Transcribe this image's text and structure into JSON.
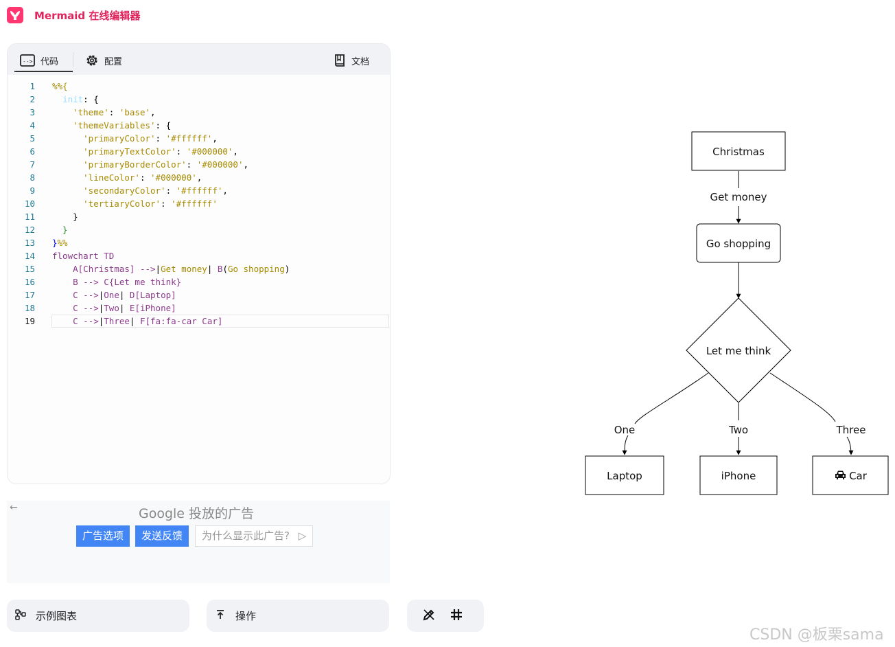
{
  "app": {
    "title": "Mermaid 在线编辑器",
    "logo_icon": "mermaid-logo-icon",
    "brand_color": "#e0245e"
  },
  "editor": {
    "tabs": {
      "code": "代码",
      "config": "配置",
      "docs": "文档"
    },
    "active_tab": "code",
    "current_line": 19,
    "lines": [
      [
        {
          "t": "%%{",
          "c": "#a68a00"
        }
      ],
      [
        {
          "t": "  ",
          "c": "#000"
        },
        {
          "t": "init",
          "c": "#9cdcfe"
        },
        {
          "t": ": {",
          "c": "#000"
        }
      ],
      [
        {
          "t": "    ",
          "c": "#000"
        },
        {
          "t": "'theme'",
          "c": "#a68a00"
        },
        {
          "t": ": ",
          "c": "#000"
        },
        {
          "t": "'base'",
          "c": "#a68a00"
        },
        {
          "t": ",",
          "c": "#000"
        }
      ],
      [
        {
          "t": "    ",
          "c": "#000"
        },
        {
          "t": "'themeVariables'",
          "c": "#a68a00"
        },
        {
          "t": ": {",
          "c": "#000"
        }
      ],
      [
        {
          "t": "      ",
          "c": "#000"
        },
        {
          "t": "'primaryColor'",
          "c": "#a68a00"
        },
        {
          "t": ": ",
          "c": "#000"
        },
        {
          "t": "'#ffffff'",
          "c": "#a68a00"
        },
        {
          "t": ",",
          "c": "#000"
        }
      ],
      [
        {
          "t": "      ",
          "c": "#000"
        },
        {
          "t": "'primaryTextColor'",
          "c": "#a68a00"
        },
        {
          "t": ": ",
          "c": "#000"
        },
        {
          "t": "'#000000'",
          "c": "#a68a00"
        },
        {
          "t": ",",
          "c": "#000"
        }
      ],
      [
        {
          "t": "      ",
          "c": "#000"
        },
        {
          "t": "'primaryBorderColor'",
          "c": "#a68a00"
        },
        {
          "t": ": ",
          "c": "#000"
        },
        {
          "t": "'#000000'",
          "c": "#a68a00"
        },
        {
          "t": ",",
          "c": "#000"
        }
      ],
      [
        {
          "t": "      ",
          "c": "#000"
        },
        {
          "t": "'lineColor'",
          "c": "#a68a00"
        },
        {
          "t": ": ",
          "c": "#000"
        },
        {
          "t": "'#000000'",
          "c": "#a68a00"
        },
        {
          "t": ",",
          "c": "#000"
        }
      ],
      [
        {
          "t": "      ",
          "c": "#000"
        },
        {
          "t": "'secondaryColor'",
          "c": "#a68a00"
        },
        {
          "t": ": ",
          "c": "#000"
        },
        {
          "t": "'#ffffff'",
          "c": "#a68a00"
        },
        {
          "t": ",",
          "c": "#000"
        }
      ],
      [
        {
          "t": "      ",
          "c": "#000"
        },
        {
          "t": "'tertiaryColor'",
          "c": "#a68a00"
        },
        {
          "t": ": ",
          "c": "#000"
        },
        {
          "t": "'#ffffff'",
          "c": "#a68a00"
        }
      ],
      [
        {
          "t": "    }",
          "c": "#000"
        }
      ],
      [
        {
          "t": "  }",
          "c": "#2e8b2e"
        }
      ],
      [
        {
          "t": "}",
          "c": "#0000ff"
        },
        {
          "t": "%%",
          "c": "#a68a00"
        }
      ],
      [
        {
          "t": "flowchart TD",
          "c": "#8b3a8b"
        }
      ],
      [
        {
          "t": "    A",
          "c": "#8b3a8b"
        },
        {
          "t": "[Christmas]",
          "c": "#8b3a8b"
        },
        {
          "t": " -->",
          "c": "#8b3a8b"
        },
        {
          "t": "|",
          "c": "#000"
        },
        {
          "t": "Get money",
          "c": "#a68a00"
        },
        {
          "t": "|",
          "c": "#000"
        },
        {
          "t": " B",
          "c": "#8b3a8b"
        },
        {
          "t": "(",
          "c": "#000"
        },
        {
          "t": "Go shopping",
          "c": "#a68a00"
        },
        {
          "t": ")",
          "c": "#000"
        }
      ],
      [
        {
          "t": "    B",
          "c": "#8b3a8b"
        },
        {
          "t": " --> ",
          "c": "#8b3a8b"
        },
        {
          "t": "C{Let me think}",
          "c": "#8b3a8b"
        }
      ],
      [
        {
          "t": "    C",
          "c": "#8b3a8b"
        },
        {
          "t": " -->",
          "c": "#8b3a8b"
        },
        {
          "t": "|",
          "c": "#000"
        },
        {
          "t": "One",
          "c": "#8b3a8b"
        },
        {
          "t": "| ",
          "c": "#000"
        },
        {
          "t": "D[Laptop]",
          "c": "#8b3a8b"
        }
      ],
      [
        {
          "t": "    C",
          "c": "#8b3a8b"
        },
        {
          "t": " -->",
          "c": "#8b3a8b"
        },
        {
          "t": "|",
          "c": "#000"
        },
        {
          "t": "Two",
          "c": "#8b3a8b"
        },
        {
          "t": "| ",
          "c": "#000"
        },
        {
          "t": "E[iPhone]",
          "c": "#8b3a8b"
        }
      ],
      [
        {
          "t": "    C",
          "c": "#8b3a8b"
        },
        {
          "t": " -->",
          "c": "#8b3a8b"
        },
        {
          "t": "|",
          "c": "#000"
        },
        {
          "t": "Three",
          "c": "#8b3a8b"
        },
        {
          "t": "| ",
          "c": "#000"
        },
        {
          "t": "F[fa:fa-car Car]",
          "c": "#8b3a8b"
        }
      ]
    ]
  },
  "ad": {
    "back_icon": "arrow-left-icon",
    "title": "Google 投放的广告",
    "options_label": "广告选项",
    "feedback_label": "发送反馈",
    "why_label": "为什么显示此广告?",
    "why_icon": "ad-choices-icon"
  },
  "bottom": {
    "examples_label": "示例图表",
    "actions_label": "操作",
    "edit_icon": "pencil-icon",
    "grid_icon": "grid-icon"
  },
  "diagram": {
    "nodes": {
      "christmas": "Christmas",
      "go_shopping": "Go shopping",
      "decision": "Let me think",
      "laptop": "Laptop",
      "iphone": "iPhone",
      "car": "Car",
      "car_icon": "car-icon"
    },
    "edges": {
      "get_money": "Get money",
      "one": "One",
      "two": "Two",
      "three": "Three"
    }
  },
  "watermark": "CSDN @板栗sama"
}
